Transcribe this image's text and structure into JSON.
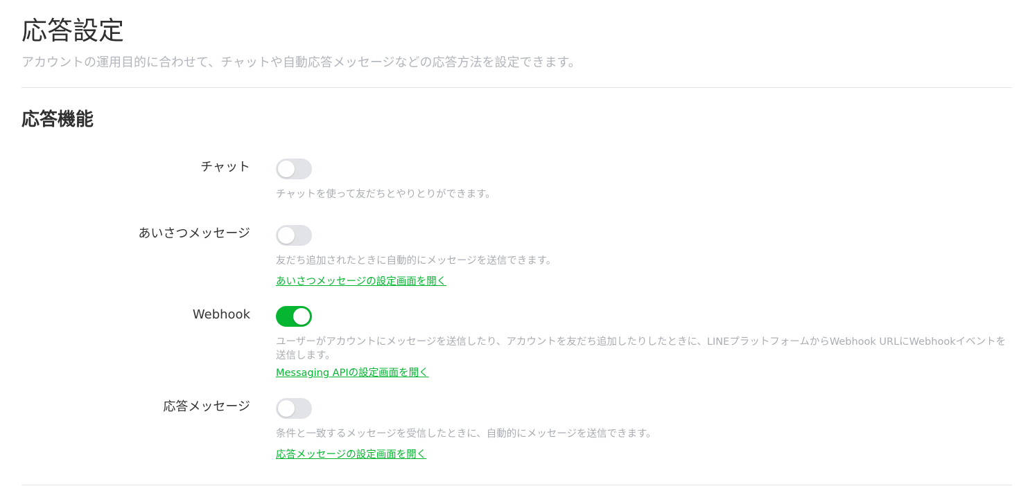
{
  "header": {
    "title": "応答設定",
    "description": "アカウントの運用目的に合わせて、チャットや自動応答メッセージなどの応答方法を設定できます。"
  },
  "section": {
    "title": "応答機能"
  },
  "settings": [
    {
      "label": "チャット",
      "enabled": false,
      "description": "チャットを使って友だちとやりとりができます。"
    },
    {
      "label": "あいさつメッセージ",
      "enabled": false,
      "description": "友だち追加されたときに自動的にメッセージを送信できます。",
      "link": "あいさつメッセージの設定画面を開く"
    },
    {
      "label": "Webhook",
      "enabled": true,
      "description": "ユーザーがアカウントにメッセージを送信したり、アカウントを友だち追加したりしたときに、LINEプラットフォームからWebhook URLにWebhookイベントを送信します。",
      "link": "Messaging APIの設定画面を開く"
    },
    {
      "label": "応答メッセージ",
      "enabled": false,
      "description": "条件と一致するメッセージを受信したときに、自動的にメッセージを送信できます。",
      "link": "応答メッセージの設定画面を開く"
    }
  ],
  "colors": {
    "accent": "#06b632",
    "toggle_off": "#e1e3e6",
    "muted_text": "#a9adb3"
  }
}
